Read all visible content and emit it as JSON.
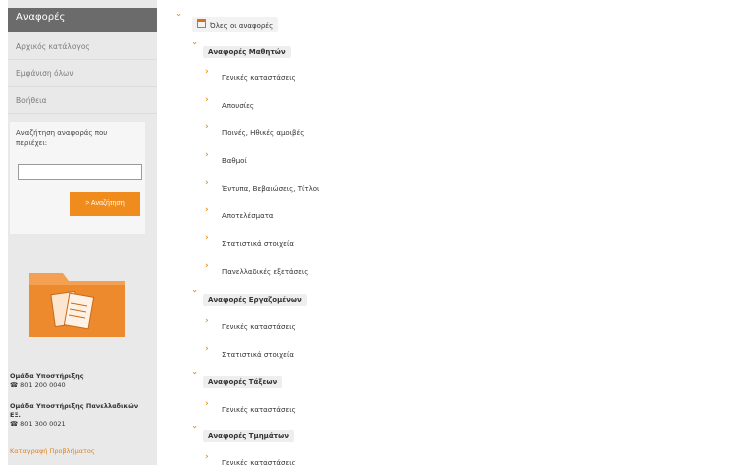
{
  "sidebar": {
    "title": "Αναφορές",
    "links": [
      "Αρχικός κατάλογος",
      "Εμφάνιση όλων",
      "Βοήθεια"
    ],
    "search": {
      "label": "Αναζήτηση αναφοράς που περιέχει:",
      "value": "",
      "button": "> Αναζήτηση"
    },
    "support": [
      {
        "name": "Ομάδα Υποστήριξης",
        "phone": "☎ 801 200 0040"
      },
      {
        "name": "Ομάδα Υποστήριξης Πανελλαδικών ΕΞ.",
        "phone": "☎ 801 300 0021"
      }
    ],
    "complaint": "Καταγραφή Προβλήματος"
  },
  "tree": {
    "root": "Όλες οι αναφορές",
    "groups": [
      {
        "label": "Αναφορές Μαθητών",
        "items": [
          "Γενικές καταστάσεις",
          "Απουσίες",
          "Ποινές, Ηθικές αμοιβές",
          "Βαθμοί",
          "Έντυπα, Βεβαιώσεις, Τίτλοι",
          "Αποτελέσματα",
          "Στατιστικά στοιχεία",
          "Πανελλαδικές εξετάσεις"
        ]
      },
      {
        "label": "Αναφορές Εργαζομένων",
        "items": [
          "Γενικές καταστάσεις",
          "Στατιστικά στοιχεία"
        ]
      },
      {
        "label": "Αναφορές Τάξεων",
        "items": [
          "Γενικές καταστάσεις"
        ]
      },
      {
        "label": "Αναφορές Τμημάτων",
        "items": [
          "Γενικές καταστάσεις"
        ]
      }
    ]
  },
  "colors": {
    "accent": "#f08c1e",
    "chevron": "#e39a28",
    "sidebar_header": "#6b6b6b",
    "sidebar_bg": "#e9e9e9"
  }
}
